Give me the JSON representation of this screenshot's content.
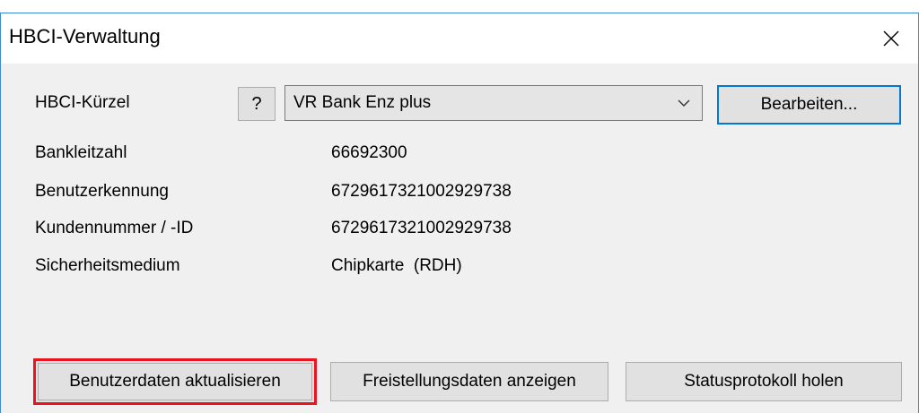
{
  "window": {
    "title": "HBCI-Verwaltung",
    "close_icon": "close-icon"
  },
  "hbci": {
    "label": "HBCI-Kürzel",
    "help_label": "?",
    "selected_bank": "VR Bank Enz plus",
    "edit_label": "Bearbeiten..."
  },
  "details": [
    {
      "label": "Bankleitzahl",
      "value": "66692300"
    },
    {
      "label": "Benutzerkennung",
      "value": "6729617321002929738"
    },
    {
      "label": "Kundennummer / -ID",
      "value": "6729617321002929738"
    },
    {
      "label": "Sicherheitsmedium",
      "value": "Chipkarte  (RDH)"
    }
  ],
  "actions": {
    "update_user_data": "Benutzerdaten aktualisieren",
    "show_release_data": "Freistellungsdaten anzeigen",
    "get_status_log": "Statusprotokoll holen"
  },
  "colors": {
    "highlight_border": "#e8141e",
    "focus_border": "#0078d7",
    "window_border": "#3c8bd8"
  }
}
